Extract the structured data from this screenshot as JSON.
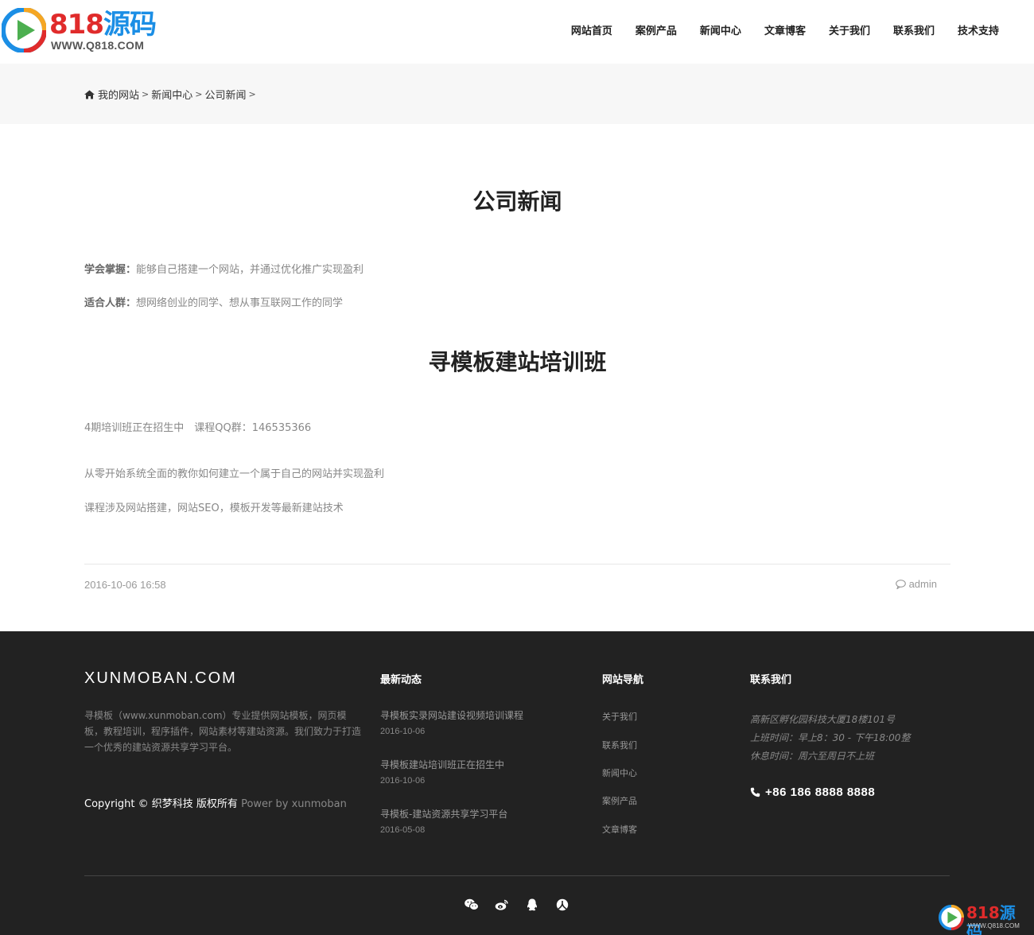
{
  "header": {
    "logo_number": "818",
    "logo_word": "源码",
    "logo_url": "WWW.Q818.COM",
    "nav": [
      "网站首页",
      "案例产品",
      "新闻中心",
      "文章博客",
      "关于我们",
      "联系我们",
      "技术支持"
    ]
  },
  "breadcrumb": {
    "items": [
      "我的网站",
      "新闻中心",
      "公司新闻"
    ],
    "separator": ">"
  },
  "article": {
    "title": "公司新闻",
    "line1_label": "学会掌握：",
    "line1_text": "能够自己搭建一个网站，并通过优化推广实现盈利",
    "line2_label": "适合人群：",
    "line2_text": "想网络创业的同学、想从事互联网工作的同学",
    "subtitle": "寻模板建站培训班",
    "para1": "4期培训班正在招生中　课程QQ群：146535366",
    "para2": "从零开始系统全面的教你如何建立一个属于自己的网站并实现盈利",
    "para3": "课程涉及网站搭建，网站SEO，模板开发等最新建站技术",
    "date": "2016-10-06 16:58",
    "author": "admin"
  },
  "footer": {
    "brand": "XUNMOBAN.COM",
    "description": "寻模板（www.xunmoban.com）专业提供网站模板，网页模板，教程培训，程序插件，网站素材等建站资源。我们致力于打造一个优秀的建站资源共享学习平台。",
    "copyright": "Copyright © 织梦科技 版权所有",
    "power": "Power by xunmoban",
    "news_heading": "最新动态",
    "news": [
      {
        "title": "寻模板实录网站建设视频培训课程",
        "date": "2016-10-06"
      },
      {
        "title": "寻模板建站培训班正在招生中",
        "date": "2016-10-06"
      },
      {
        "title": "寻模板-建站资源共享学习平台",
        "date": "2016-05-08"
      }
    ],
    "nav_heading": "网站导航",
    "nav": [
      "关于我们",
      "联系我们",
      "新闻中心",
      "案例产品",
      "文章博客"
    ],
    "contact_heading": "联系我们",
    "address": "高新区孵化园科技大厦18楼101号",
    "hours": "上班时间：早上8：30 - 下午18:00整",
    "rest": "休息时间：周六至周日不上班",
    "phone": "+86 186 8888 8888"
  },
  "icons": {
    "home": "home-icon",
    "comment": "comment-icon",
    "phone": "phone-icon",
    "social": [
      "wechat-icon",
      "weibo-icon",
      "qq-icon",
      "renren-icon"
    ]
  },
  "colors": {
    "logo_red": "#e02b2b",
    "logo_blue": "#1b8ee5",
    "footer_bg": "#222222",
    "crumb_bg": "#f7f7f7"
  }
}
